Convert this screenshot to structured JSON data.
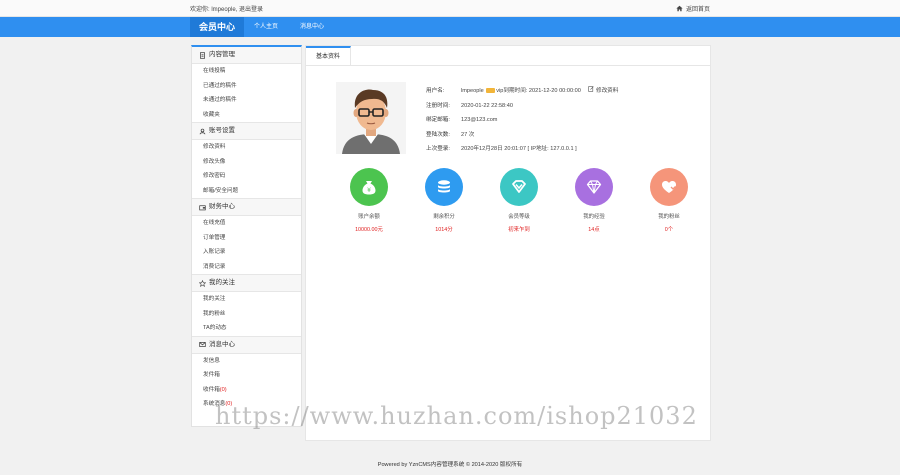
{
  "topbar": {
    "welcome_prefix": "欢迎你:",
    "username": "lmpeople",
    "separator": ",",
    "logout": "退出登录",
    "home": "返回首页"
  },
  "nav": {
    "brand": "会员中心",
    "links": [
      "个人主页",
      "消息中心"
    ]
  },
  "sidebar": {
    "groups": [
      {
        "title": "内容管理",
        "icon": "document-icon",
        "items": [
          "在线投稿",
          "已通过的稿件",
          "未通过的稿件",
          "收藏夹"
        ]
      },
      {
        "title": "账号设置",
        "icon": "user-icon",
        "items": [
          "修改资料",
          "修改头像",
          "修改密码",
          "邮箱/安全问题"
        ]
      },
      {
        "title": "财务中心",
        "icon": "wallet-icon",
        "items": [
          "在线充值",
          "订单管理",
          "入账记录",
          "消费记录"
        ]
      },
      {
        "title": "我的关注",
        "icon": "star-icon",
        "items": [
          "我的关注",
          "我的粉丝",
          "TA的动态"
        ]
      },
      {
        "title": "消息中心",
        "icon": "mail-icon",
        "items": [
          "发信息",
          "发件箱",
          "收件箱",
          "系统消息"
        ]
      }
    ],
    "inbox_count": "(0)",
    "system_count": "(0)"
  },
  "panel": {
    "tab": "基本资料",
    "labels": {
      "username": "用户名:",
      "reg": "注册时间:",
      "email": "绑定邮箱:",
      "logins": "登陆次数:",
      "last": "上次登录:"
    },
    "username": "lmpeople",
    "vip_text": "vip到期时间: 2021-12-20 00:00:00",
    "edit": "修改资料",
    "reg_time": "2020-01-22 22:58:40",
    "email": "123@123.com",
    "login_count": "27 次",
    "last_login": "2020年12月28日 20:01:07 [ IP地址: 127.0.0.1 ]"
  },
  "stats": [
    {
      "label": "账户余额",
      "value": "10000.00元",
      "color": "#4cc44f",
      "icon": "money-bag-icon"
    },
    {
      "label": "剩余积分",
      "value": "1014分",
      "color": "#2e9bf0",
      "icon": "coins-icon"
    },
    {
      "label": "会员等级",
      "value": "初来乍到",
      "color": "#3cc7c4",
      "icon": "diamond-icon"
    },
    {
      "label": "我的经验",
      "value": "14点",
      "color": "#a870e0",
      "icon": "gem-icon"
    },
    {
      "label": "我的粉丝",
      "value": "0个",
      "color": "#f5957a",
      "icon": "heart-icon"
    }
  ],
  "footer": "Powered by YznCMS内容管理系统 © 2014-2020 版权所有",
  "watermark": "https://www.huzhan.com/ishop21032"
}
